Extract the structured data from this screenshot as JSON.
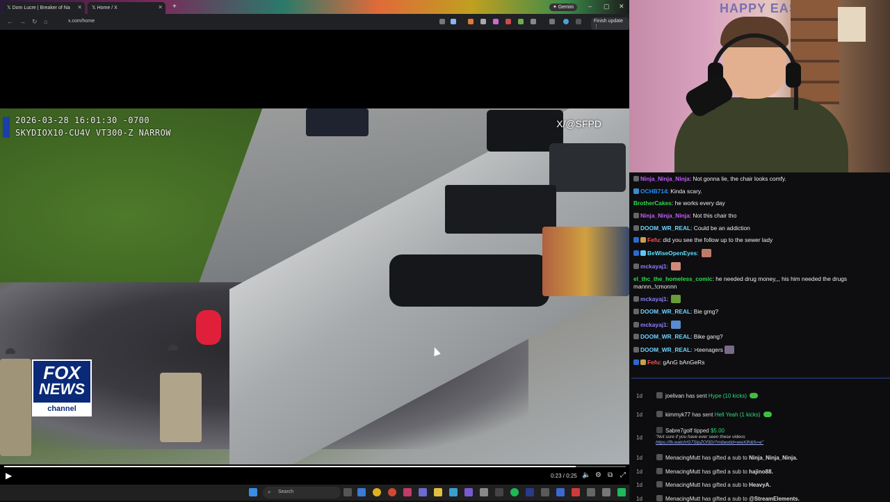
{
  "browser": {
    "tabs": [
      {
        "label": "Dom Lucre | Breaker of Na"
      },
      {
        "label": "Home / X"
      }
    ],
    "gemini_label": "Gemini",
    "url": "x.com/home",
    "finish_update": "Finish update",
    "window_controls": [
      "–",
      "▢",
      "✕"
    ]
  },
  "video": {
    "osd_line1": "2026-03-28 16:01:30 -0700",
    "osd_line2": "SKYDIOX10-CU4V VT300-Z NARROW",
    "credit": "X/@SFPD",
    "logo_word1": "FOX",
    "logo_word2": "NEWS",
    "logo_word3": "channel",
    "time": "0:23 / 0:25",
    "progress_fraction": 0.92
  },
  "taskbar": {
    "search_placeholder": "Search"
  },
  "webcam": {
    "banner": "HAPPY EASTER"
  },
  "chat": {
    "messages": [
      {
        "user": "Ninja_Ninja_Ninja",
        "color": "#c45cff",
        "text": "Not gonna lie, the chair looks comfy."
      },
      {
        "user": "OCHB714",
        "color": "#1e90ff",
        "text": "Kinda scary."
      },
      {
        "user": "BrotherCakes",
        "color": "#2fdc4f",
        "text": "he works every day"
      },
      {
        "user": "Ninja_Ninja_Ninja",
        "color": "#c45cff",
        "text": "Not this chair tho"
      },
      {
        "user": "DOOM_WR_REAL",
        "color": "#6fd3ff",
        "text": "Could be an addiction"
      },
      {
        "user": "Fefu",
        "color": "#ff5050",
        "text": "did you see the follow up to the sewer lady"
      },
      {
        "user": "BeWiseOpenEyes",
        "color": "#5fe0ff",
        "text": ""
      },
      {
        "user": "mckayaj1",
        "color": "#8a7dff",
        "text": ""
      },
      {
        "user": "el_thc_the_homeless_comic",
        "color": "#2fdc4f",
        "text": "he needed drug money,,, his him needed the drugs mannn,,!cmonnn"
      },
      {
        "user": "mckayaj1",
        "color": "#8a7dff",
        "text": ""
      },
      {
        "user": "DOOM_WR_REAL",
        "color": "#6fd3ff",
        "text": "Bie gmg?"
      },
      {
        "user": "mckayaj1",
        "color": "#8a7dff",
        "text": ""
      },
      {
        "user": "DOOM_WR_REAL",
        "color": "#6fd3ff",
        "text": "Bike gang?"
      },
      {
        "user": "DOOM_WR_REAL",
        "color": "#6fd3ff",
        "text": ">teenagers"
      },
      {
        "user": "Fefu",
        "color": "#ff5050",
        "text": "gAnG bAnGeRs"
      }
    ]
  },
  "events": {
    "items": [
      {
        "age": "1d",
        "name": "joelivan",
        "verb": "has sent",
        "item": "Hype (10 kicks)"
      },
      {
        "age": "1d",
        "name": "kimmyk77",
        "verb": "has sent",
        "item": "Hell Yeah (1 kicks)"
      },
      {
        "age": "1d",
        "name": "Sabre7golf",
        "verb": "tipped",
        "item": "$5.00"
      },
      {
        "age": "1d",
        "name": "MenacingMutt",
        "verb": "has gifted a sub to",
        "item": "Ninja_Ninja_Ninja."
      },
      {
        "age": "1d",
        "name": "MenacingMutt",
        "verb": "has gifted a sub to",
        "item": "hajino88."
      },
      {
        "age": "1d",
        "name": "MenacingMutt",
        "verb": "has gifted a sub to",
        "item": "HeavyA."
      },
      {
        "age": "1d",
        "name": "MenacingMutt",
        "verb": "has gifted a sub to",
        "item": "@StreamElements."
      }
    ],
    "tip_note": "\"Not sure if you have ever seen these videos",
    "tip_link": "https://fb.watch/G7StpZOf3D/?mibextid=wwXIfr&fs=e\""
  }
}
